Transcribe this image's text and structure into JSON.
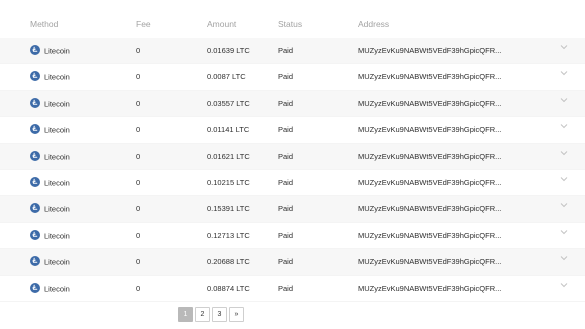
{
  "headers": {
    "method": "Method",
    "fee": "Fee",
    "amount": "Amount",
    "status": "Status",
    "address": "Address"
  },
  "rows": [
    {
      "method": "Litecoin",
      "fee": "0",
      "amount": "0.01639 LTC",
      "status": "Paid",
      "address": "MUZyzEvKu9NABWt5VEdF39hGpicQFR..."
    },
    {
      "method": "Litecoin",
      "fee": "0",
      "amount": "0.0087 LTC",
      "status": "Paid",
      "address": "MUZyzEvKu9NABWt5VEdF39hGpicQFR..."
    },
    {
      "method": "Litecoin",
      "fee": "0",
      "amount": "0.03557 LTC",
      "status": "Paid",
      "address": "MUZyzEvKu9NABWt5VEdF39hGpicQFR..."
    },
    {
      "method": "Litecoin",
      "fee": "0",
      "amount": "0.01141 LTC",
      "status": "Paid",
      "address": "MUZyzEvKu9NABWt5VEdF39hGpicQFR..."
    },
    {
      "method": "Litecoin",
      "fee": "0",
      "amount": "0.01621 LTC",
      "status": "Paid",
      "address": "MUZyzEvKu9NABWt5VEdF39hGpicQFR..."
    },
    {
      "method": "Litecoin",
      "fee": "0",
      "amount": "0.10215 LTC",
      "status": "Paid",
      "address": "MUZyzEvKu9NABWt5VEdF39hGpicQFR..."
    },
    {
      "method": "Litecoin",
      "fee": "0",
      "amount": "0.15391 LTC",
      "status": "Paid",
      "address": "MUZyzEvKu9NABWt5VEdF39hGpicQFR..."
    },
    {
      "method": "Litecoin",
      "fee": "0",
      "amount": "0.12713 LTC",
      "status": "Paid",
      "address": "MUZyzEvKu9NABWt5VEdF39hGpicQFR..."
    },
    {
      "method": "Litecoin",
      "fee": "0",
      "amount": "0.20688 LTC",
      "status": "Paid",
      "address": "MUZyzEvKu9NABWt5VEdF39hGpicQFR..."
    },
    {
      "method": "Litecoin",
      "fee": "0",
      "amount": "0.08874 LTC",
      "status": "Paid",
      "address": "MUZyzEvKu9NABWt5VEdF39hGpicQFR..."
    }
  ],
  "icons": {
    "method": "litecoin-icon",
    "expand": "chevron-down-icon"
  },
  "pagination": {
    "pages": [
      "1",
      "2",
      "3"
    ],
    "current": "1",
    "next_label": "»"
  },
  "colors": {
    "litecoin": "#3d6ba8",
    "active_page": "#b9b9b9",
    "header_text": "#a3a3a3"
  }
}
